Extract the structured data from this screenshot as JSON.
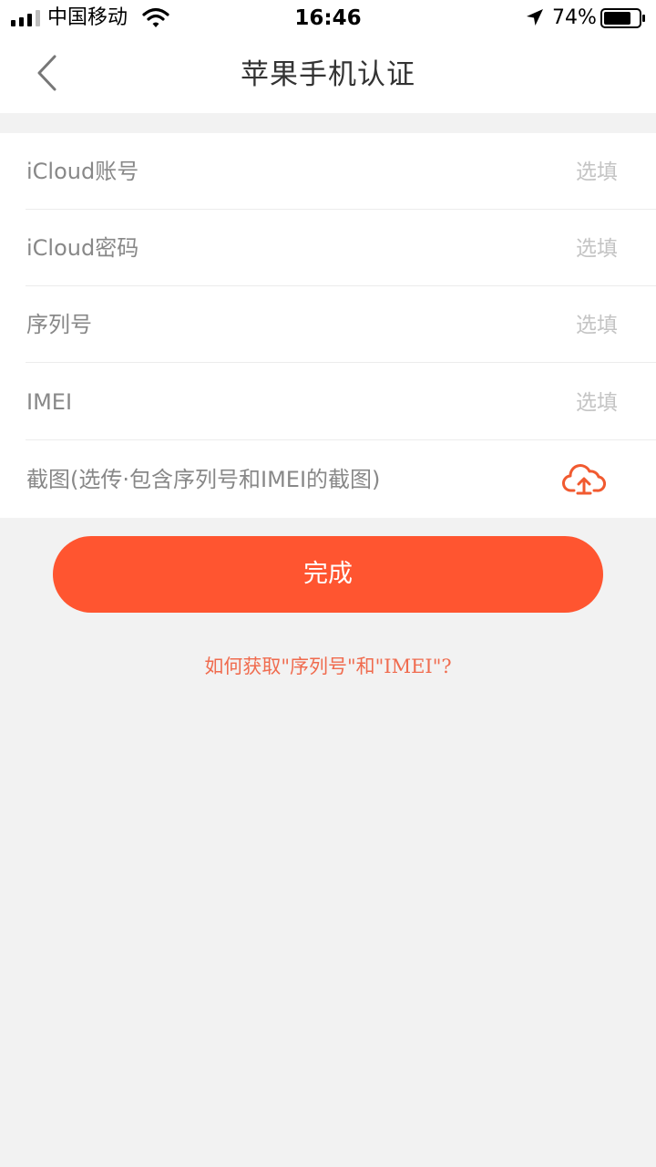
{
  "status_bar": {
    "carrier": "中国移动",
    "time": "16:46",
    "battery": "74%",
    "icons": [
      "signal-icon",
      "wifi-icon",
      "location-arrow-icon",
      "battery-icon"
    ]
  },
  "nav": {
    "title": "苹果手机认证",
    "back_icon": "chevron-left-icon"
  },
  "form": {
    "rows": [
      {
        "label": "iCloud账号",
        "placeholder": "选填",
        "value": ""
      },
      {
        "label": "iCloud密码",
        "placeholder": "选填",
        "value": ""
      },
      {
        "label": "序列号",
        "placeholder": "选填",
        "value": ""
      },
      {
        "label": "IMEI",
        "placeholder": "选填",
        "value": ""
      }
    ],
    "screenshot": {
      "label": "截图(选传·包含序列号和IMEI的截图)",
      "icon": "cloud-upload-icon"
    }
  },
  "submit_label": "完成",
  "help_link": "如何获取\"序列号\"和\"IMEI\"?",
  "colors": {
    "accent": "#ff5530",
    "link": "#f06b4e",
    "background": "#f2f2f2"
  }
}
